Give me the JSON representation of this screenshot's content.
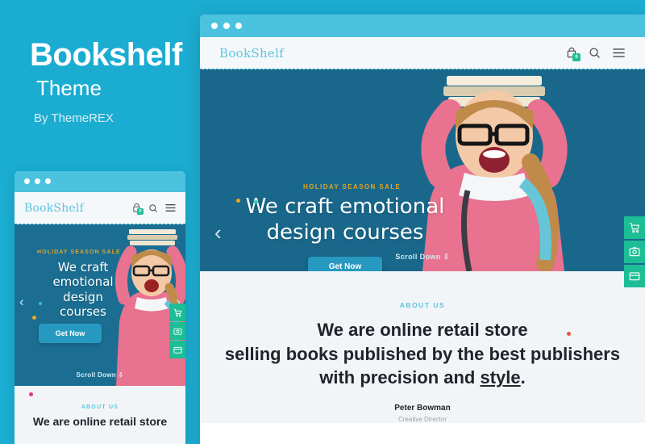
{
  "promo": {
    "title": "Bookshelf",
    "subtitle": "Theme",
    "author": "By ThemeREX"
  },
  "colors": {
    "background": "#1BACD1",
    "titlebar": "#4BC3DF",
    "accent_green": "#1DBE96",
    "hero_bg": "#19688C",
    "button_blue": "#2799C0",
    "gold": "#E0A526",
    "logo_blue": "#5BC4E0",
    "about_bg": "#F2F5F8"
  },
  "window": {
    "titlebar_dots": [
      "dot",
      "dot",
      "dot"
    ],
    "header": {
      "logo": "BookShelf",
      "cart_badge": "0",
      "icons": [
        "cart-icon",
        "search-icon",
        "menu-icon"
      ]
    },
    "hero": {
      "kicker": "HOLIDAY SEASON SALE",
      "heading_line1": "We craft emotional",
      "heading_line2": "design courses",
      "button": "Get Now",
      "scroll_label": "Scroll Down",
      "prev_arrow": "‹",
      "next_arrow": "›"
    },
    "about": {
      "kicker": "ABOUT US",
      "line1": "We are online retail store",
      "line2": "selling books published by the best publishers",
      "line3_pre": "with precision and ",
      "line3_link": "style",
      "line3_post": ".",
      "person_name": "Peter Bowman",
      "person_role": "Creative Director"
    },
    "side_buttons": [
      "cart-icon",
      "gallery-icon",
      "layout-icon"
    ]
  },
  "mini_preview": {
    "header": {
      "logo": "BookShelf",
      "cart_badge": "0"
    },
    "hero": {
      "kicker": "HOLIDAY SEASON SALE",
      "heading_line1": "We craft",
      "heading_line2": "emotional",
      "heading_line3": "design",
      "heading_line4": "courses",
      "button": "Get Now",
      "scroll_label": "Scroll Down",
      "prev_arrow": "‹",
      "next_arrow": "›"
    },
    "about": {
      "kicker": "ABOUT US",
      "line1": "We are online retail store"
    }
  }
}
